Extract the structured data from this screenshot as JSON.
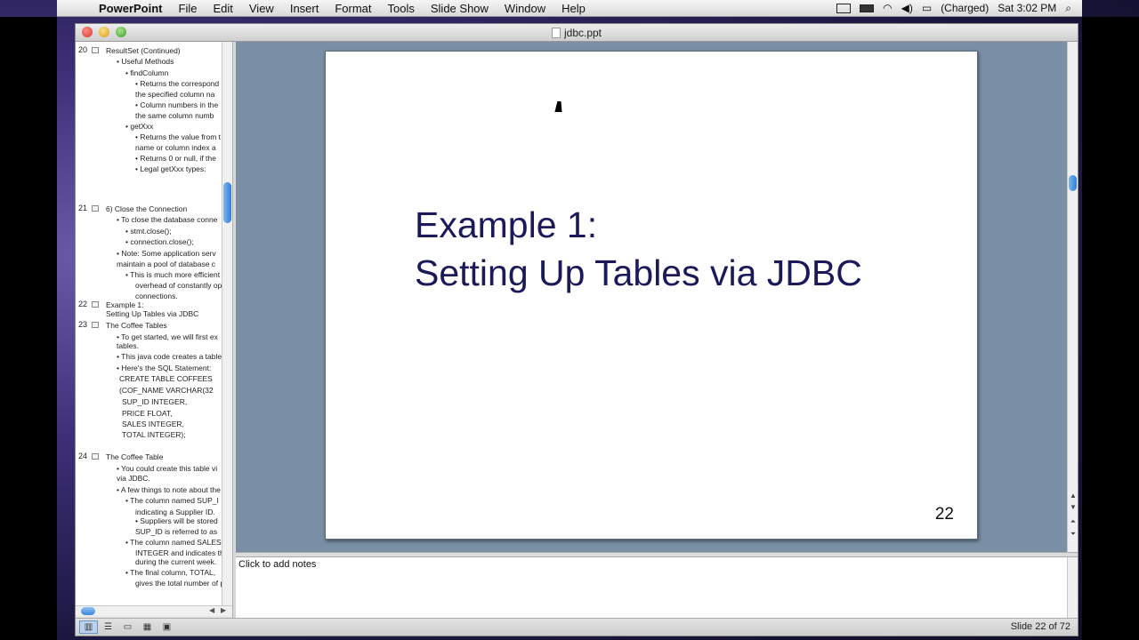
{
  "menubar": {
    "app": "PowerPoint",
    "items": [
      "File",
      "Edit",
      "View",
      "Insert",
      "Format",
      "Tools",
      "Slide Show",
      "Window",
      "Help"
    ],
    "battery": "(Charged)",
    "clock": "Sat 3:02 PM"
  },
  "window": {
    "title": "jdbc.ppt"
  },
  "outline": {
    "rows": [
      {
        "num": "20",
        "text": "ResultSet (Continued)",
        "indent": 0
      },
      {
        "text": "• Useful Methods",
        "indent": 1
      },
      {
        "text": "• findColumn",
        "indent": 2
      },
      {
        "text": "• Returns the correspond",
        "indent": 3
      },
      {
        "text": "the specified column na",
        "indent": 4
      },
      {
        "text": "• Column numbers in the",
        "indent": 3
      },
      {
        "text": "the same column numb",
        "indent": 4
      },
      {
        "text": "• getXxx",
        "indent": 2
      },
      {
        "text": "• Returns the value from t",
        "indent": 3
      },
      {
        "text": "name or column index a",
        "indent": 4
      },
      {
        "text": "• Returns 0 or null, if the",
        "indent": 3
      },
      {
        "text": "• Legal getXxx types:",
        "indent": 3
      },
      {
        "num": "21",
        "text": "6)  Close the Connection",
        "indent": 0
      },
      {
        "text": "• To close the database conne",
        "indent": 1
      },
      {
        "text": "• stmt.close();",
        "indent": 2
      },
      {
        "text": "• connection.close();",
        "indent": 2
      },
      {
        "text": "• Note:  Some application serv",
        "indent": 1
      },
      {
        "text": "maintain a pool of database c",
        "indent": 5
      },
      {
        "text": "• This is much more efficient",
        "indent": 2
      },
      {
        "text": "overhead of constantly ope",
        "indent": 4
      },
      {
        "text": "connections.",
        "indent": 4
      },
      {
        "num": "22",
        "text": "Example 1:",
        "indent": 0
      },
      {
        "text": "Setting Up Tables via JDBC",
        "indent": 0
      },
      {
        "num": "23",
        "text": "The Coffee Tables",
        "indent": 0
      },
      {
        "text": "• To get started, we will first ex",
        "indent": 1
      },
      {
        "text": "tables.",
        "indent": 5
      },
      {
        "text": "• This java code creates a table",
        "indent": 1
      },
      {
        "text": "• Here's the SQL Statement:",
        "indent": 1
      },
      {
        "text": "CREATE TABLE COFFEES",
        "indent": 6
      },
      {
        "text": "(COF_NAME VARCHAR(32",
        "indent": 6
      },
      {
        "text": "SUP_ID INTEGER,",
        "indent": 7
      },
      {
        "text": "PRICE FLOAT,",
        "indent": 7
      },
      {
        "text": "SALES INTEGER,",
        "indent": 7
      },
      {
        "text": "TOTAL INTEGER);",
        "indent": 7
      },
      {
        "num": "24",
        "text": "The Coffee Table",
        "indent": 0
      },
      {
        "text": "• You could create this table vi",
        "indent": 1
      },
      {
        "text": "via JDBC.",
        "indent": 5
      },
      {
        "text": "• A few things to note about the",
        "indent": 1
      },
      {
        "text": "• The column named SUP_I",
        "indent": 2
      },
      {
        "text": "indicating a Supplier ID.",
        "indent": 4
      },
      {
        "text": "• Suppliers will be stored",
        "indent": 3
      },
      {
        "text": "SUP_ID is referred to as",
        "indent": 4
      },
      {
        "text": "• The column named SALES",
        "indent": 2
      },
      {
        "text": "INTEGER and indicates th",
        "indent": 4
      },
      {
        "text": "during the current week.",
        "indent": 4
      },
      {
        "text": "• The final column, TOTAL,",
        "indent": 2
      },
      {
        "text": "gives the total number of p",
        "indent": 4
      }
    ]
  },
  "slide": {
    "title_line1": "Example 1:",
    "title_line2": "Setting Up Tables via JDBC",
    "number": "22"
  },
  "notes": {
    "placeholder": "Click to add notes"
  },
  "status": {
    "text": "Slide 22 of 72"
  },
  "colors": {
    "slide_title": "#1a1a5a",
    "slide_background_area": "#7a8fa6"
  }
}
